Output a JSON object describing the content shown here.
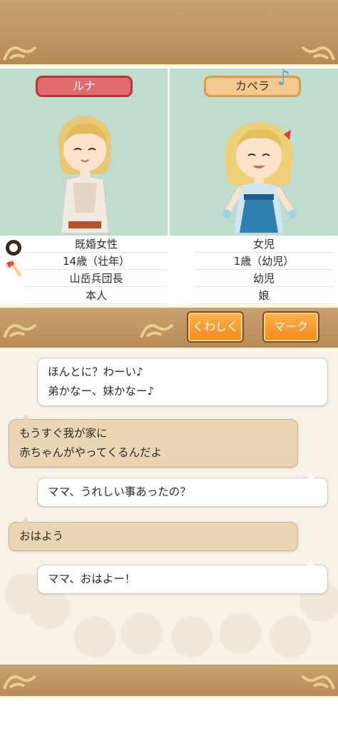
{
  "characters": {
    "left": {
      "name": "ルナ",
      "rows": [
        "既婚女性",
        "14歳（壮年）",
        "山岳兵団長",
        "本人"
      ]
    },
    "right": {
      "name": "カペラ",
      "rows": [
        "女児",
        "1歳（幼児）",
        "幼児",
        "娘"
      ]
    }
  },
  "icons": {
    "ring": "ring-icon",
    "axe": "axe-icon",
    "music": "music-note-icon"
  },
  "buttons": {
    "detail": "くわしく",
    "mark": "マーク"
  },
  "messages": [
    {
      "side": "mine",
      "lines": [
        "ほんとに？わーい♪",
        "弟かなー、妹かなー♪"
      ]
    },
    {
      "side": "theirs",
      "lines": [
        "もうすぐ我が家に",
        "赤ちゃんがやってくるんだよ"
      ]
    },
    {
      "side": "mine",
      "lines": [
        "ママ、うれしい事あったの？"
      ]
    },
    {
      "side": "theirs",
      "lines": [
        "おはよう"
      ]
    },
    {
      "side": "mine",
      "lines": [
        "ママ、おはよー！"
      ]
    }
  ],
  "colors": {
    "band": "#c9a271",
    "panel": "#bfdccd",
    "luna_tag": "#e26b6b",
    "capella_tag": "#f3c98d",
    "button": "#f28a1c"
  }
}
